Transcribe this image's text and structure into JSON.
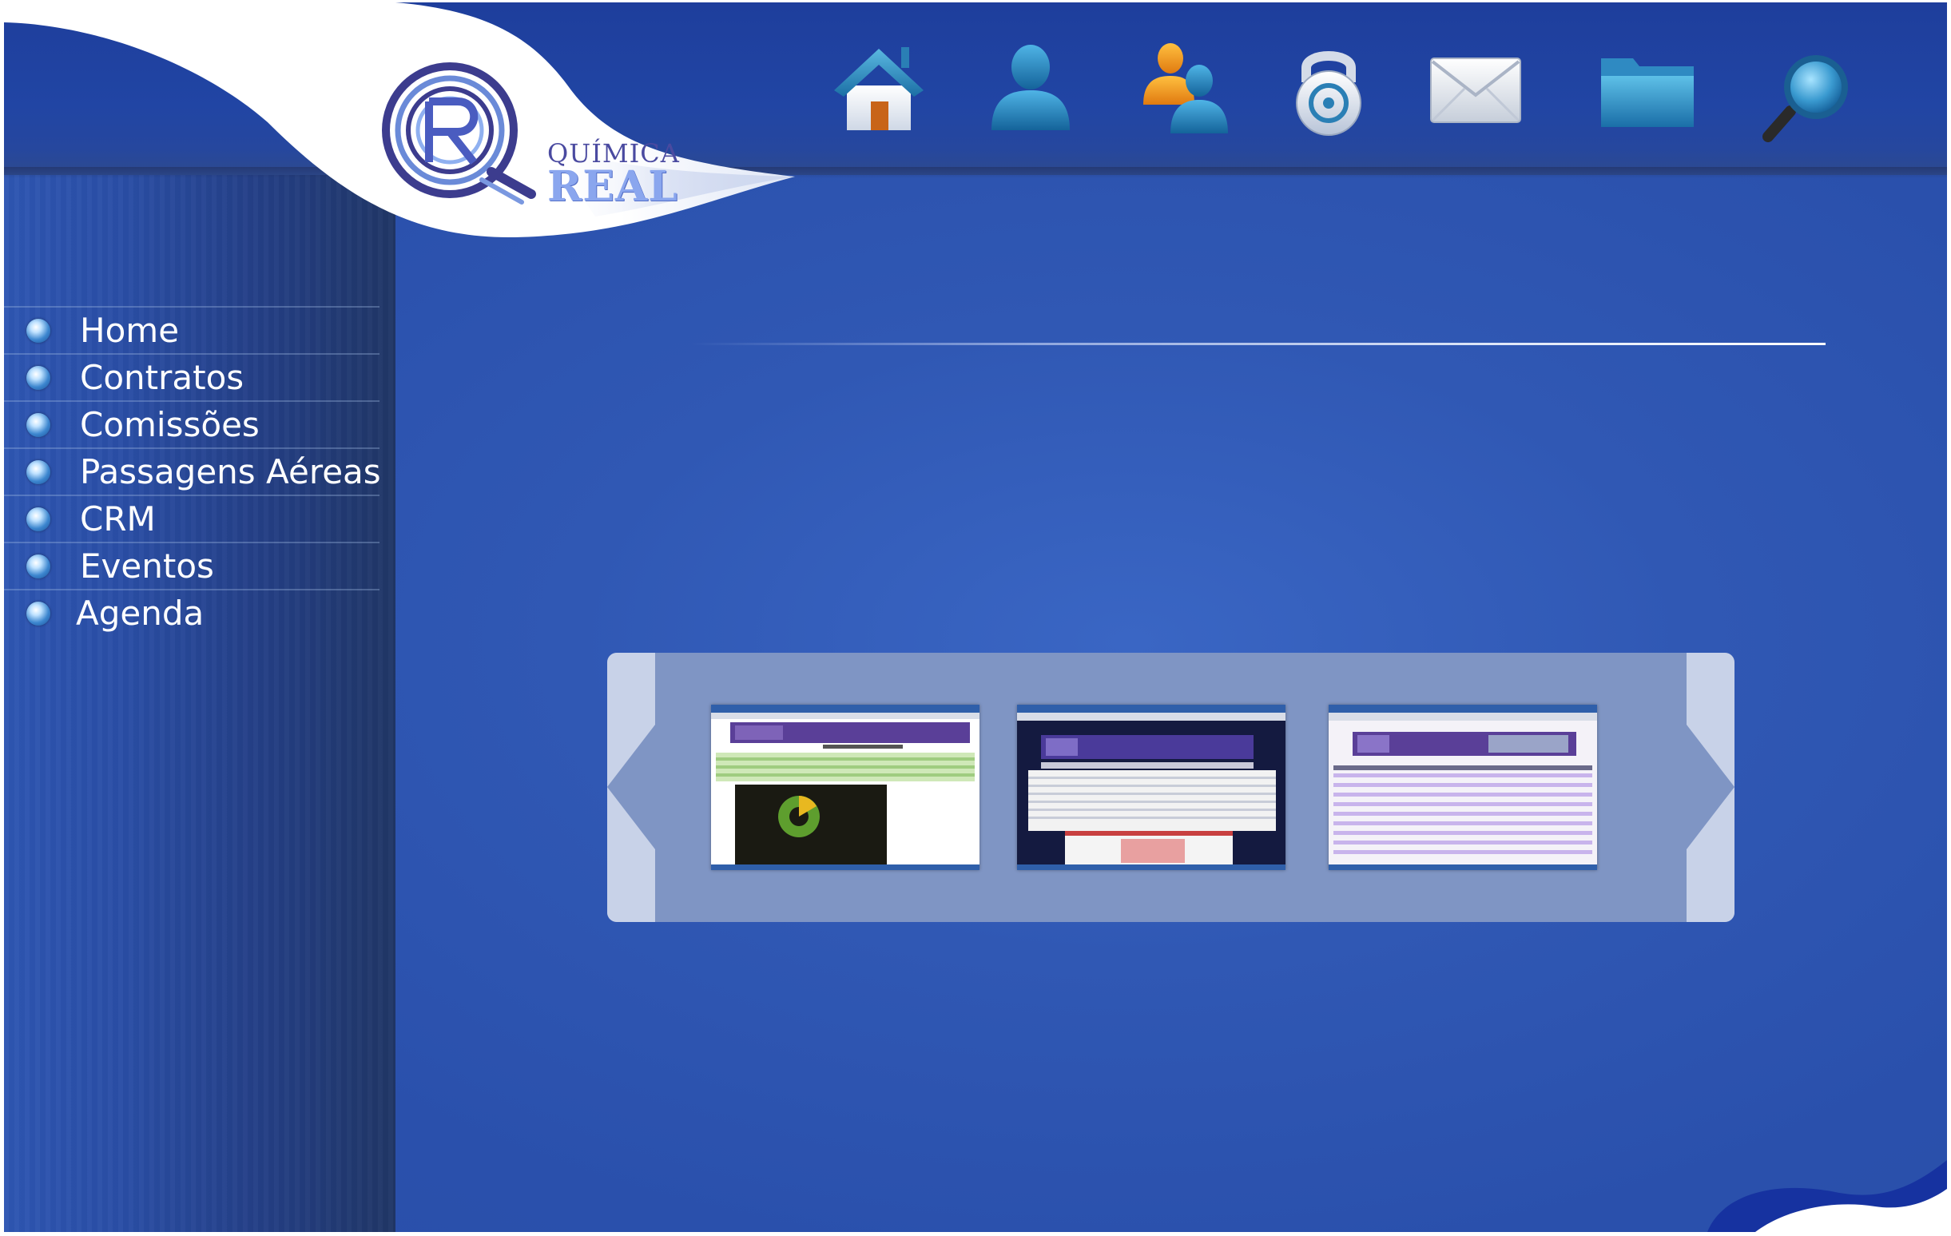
{
  "brand": {
    "line1": "QUÍMICA",
    "line2": "REAL"
  },
  "toolbar": {
    "icons": [
      "home-icon",
      "user-icon",
      "users-icon",
      "lock-icon",
      "mail-icon",
      "folder-icon",
      "search-icon"
    ]
  },
  "menu": {
    "items": [
      {
        "label": "Home"
      },
      {
        "label": "Contratos"
      },
      {
        "label": "Comissões"
      },
      {
        "label": "Passagens Aéreas"
      },
      {
        "label": "CRM"
      },
      {
        "label": "Eventos"
      },
      {
        "label": "Agenda"
      }
    ]
  },
  "carousel": {
    "thumbnails": [
      "report-volume-chart",
      "contracts-table",
      "commissions-table"
    ]
  },
  "colors": {
    "background": "#2e56b2",
    "sidebar": "#243f86",
    "carousel_panel": "#7f95c4",
    "carousel_arrow": "#c8d2e8"
  }
}
